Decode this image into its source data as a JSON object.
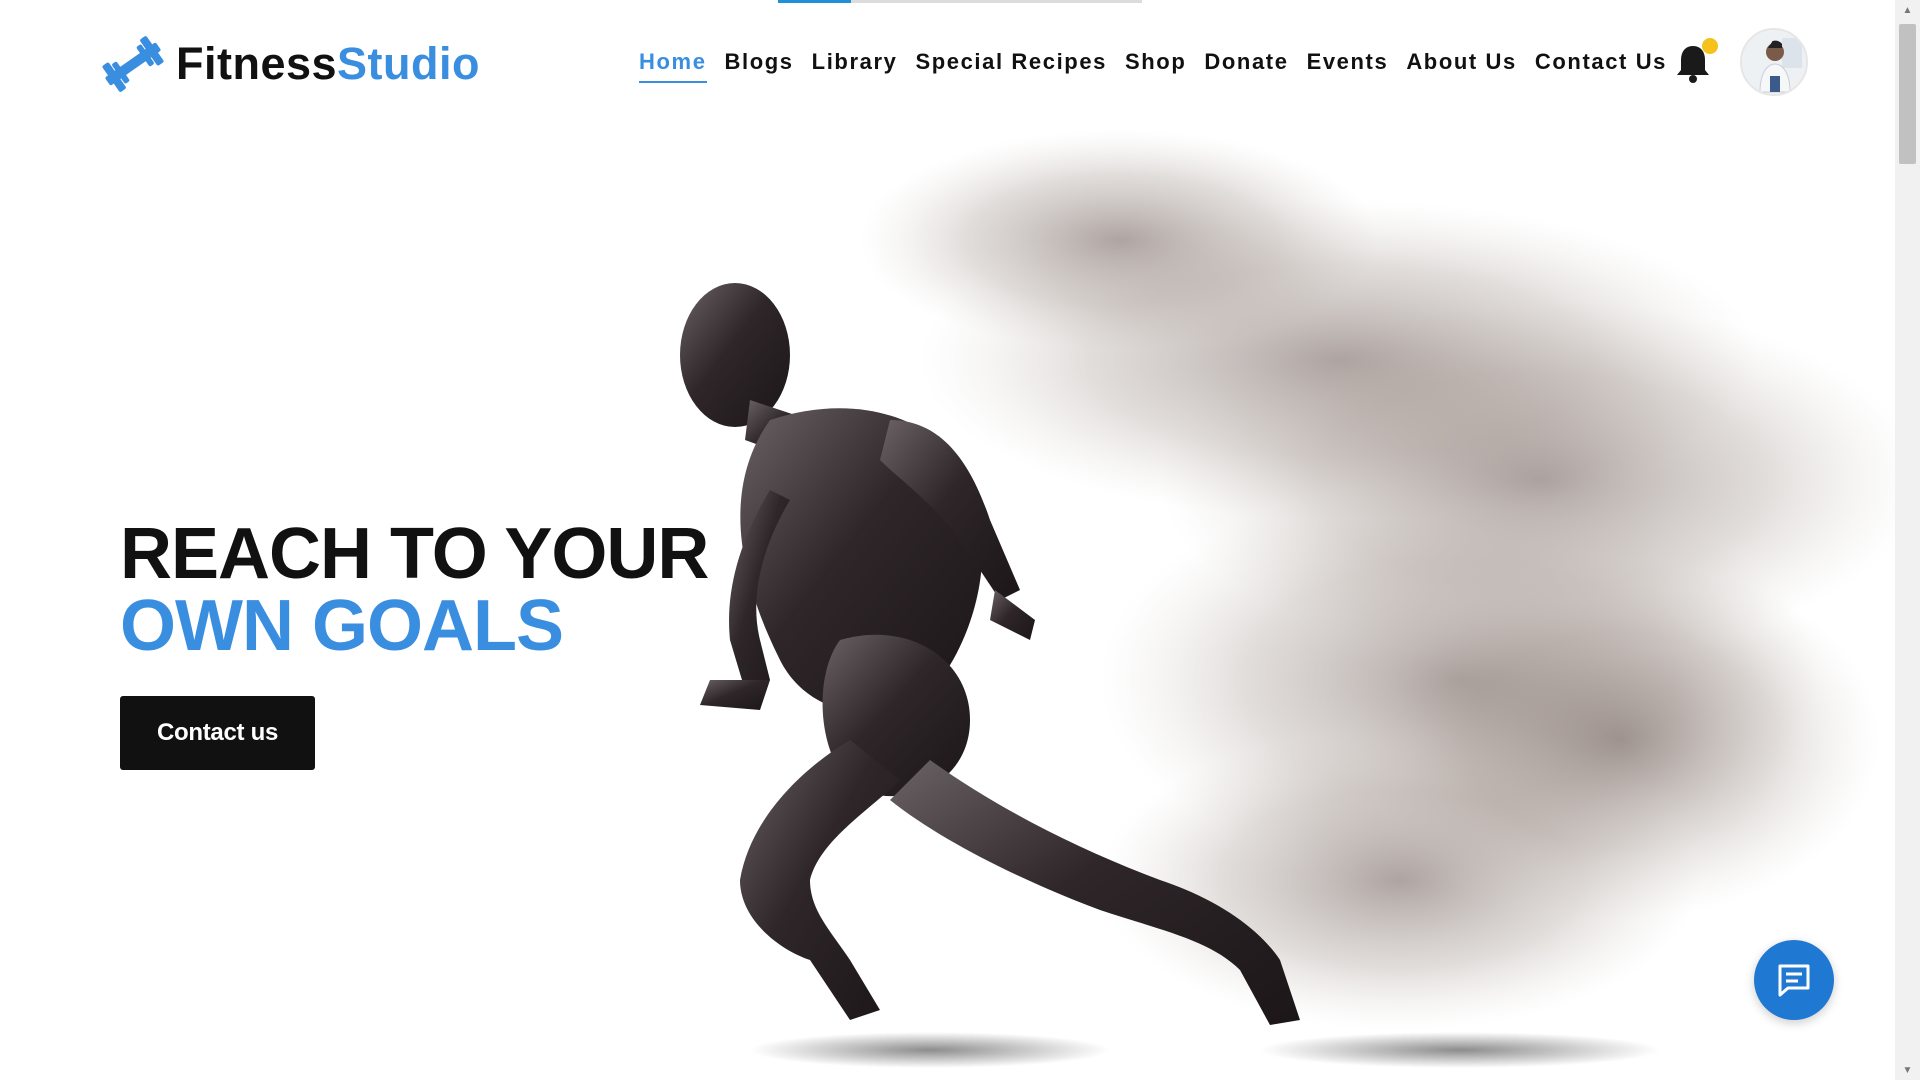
{
  "loading": {
    "progress": 0.2
  },
  "brand": {
    "part1": "Fitness",
    "part2": "Studio",
    "icon": "dumbbell-icon"
  },
  "nav": {
    "items": [
      {
        "label": "Home",
        "active": true
      },
      {
        "label": "Blogs",
        "active": false
      },
      {
        "label": "Library",
        "active": false
      },
      {
        "label": "Special Recipes",
        "active": false
      },
      {
        "label": "Shop",
        "active": false
      },
      {
        "label": "Donate",
        "active": false
      },
      {
        "label": "Events",
        "active": false
      },
      {
        "label": "About Us",
        "active": false
      },
      {
        "label": "Contact Us",
        "active": false
      }
    ]
  },
  "header": {
    "notification_icon": "bell-icon",
    "has_notification": true,
    "avatar": "user-avatar"
  },
  "hero": {
    "line1": "REACH TO YOUR",
    "line2": "OWN GOALS",
    "cta_label": "Contact us",
    "image": "running-man-particle-illustration"
  },
  "chat": {
    "icon": "chat-icon"
  },
  "colors": {
    "accent": "#3a8ee0",
    "dark": "#111111",
    "fab": "#1f78d1",
    "badge": "#f5c21b"
  }
}
